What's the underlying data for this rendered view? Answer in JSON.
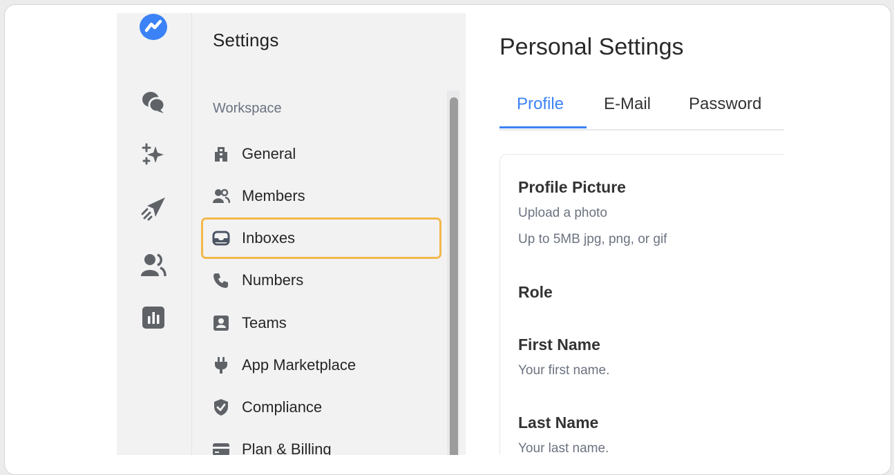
{
  "rail": {
    "icons": [
      {
        "name": "app-logo-icon"
      },
      {
        "name": "conversations-icon"
      },
      {
        "name": "ai-sparkles-icon"
      },
      {
        "name": "campaigns-send-icon"
      },
      {
        "name": "contacts-icon"
      },
      {
        "name": "reports-chart-icon"
      }
    ],
    "accent": "#3b82f6"
  },
  "sidebar": {
    "title": "Settings",
    "section_label": "Workspace",
    "items": [
      {
        "label": "General",
        "icon": "building-icon"
      },
      {
        "label": "Members",
        "icon": "members-icon"
      },
      {
        "label": "Inboxes",
        "icon": "inbox-icon",
        "active": true
      },
      {
        "label": "Numbers",
        "icon": "phone-icon"
      },
      {
        "label": "Teams",
        "icon": "id-card-icon"
      },
      {
        "label": "App Marketplace",
        "icon": "plug-icon"
      },
      {
        "label": "Compliance",
        "icon": "shield-icon"
      },
      {
        "label": "Plan & Billing",
        "icon": "credit-card-icon"
      }
    ],
    "highlight_color": "#f2b84b"
  },
  "main": {
    "title": "Personal Settings",
    "tabs": [
      {
        "label": "Profile",
        "active": true
      },
      {
        "label": "E-Mail"
      },
      {
        "label": "Password"
      }
    ],
    "card": {
      "profile_picture": {
        "label": "Profile Picture",
        "help1": "Upload a photo",
        "help2": "Up to 5MB jpg, png, or gif"
      },
      "role": {
        "label": "Role"
      },
      "first_name": {
        "label": "First Name",
        "help": "Your first name."
      },
      "last_name": {
        "label": "Last Name",
        "help": "Your last name."
      }
    }
  }
}
